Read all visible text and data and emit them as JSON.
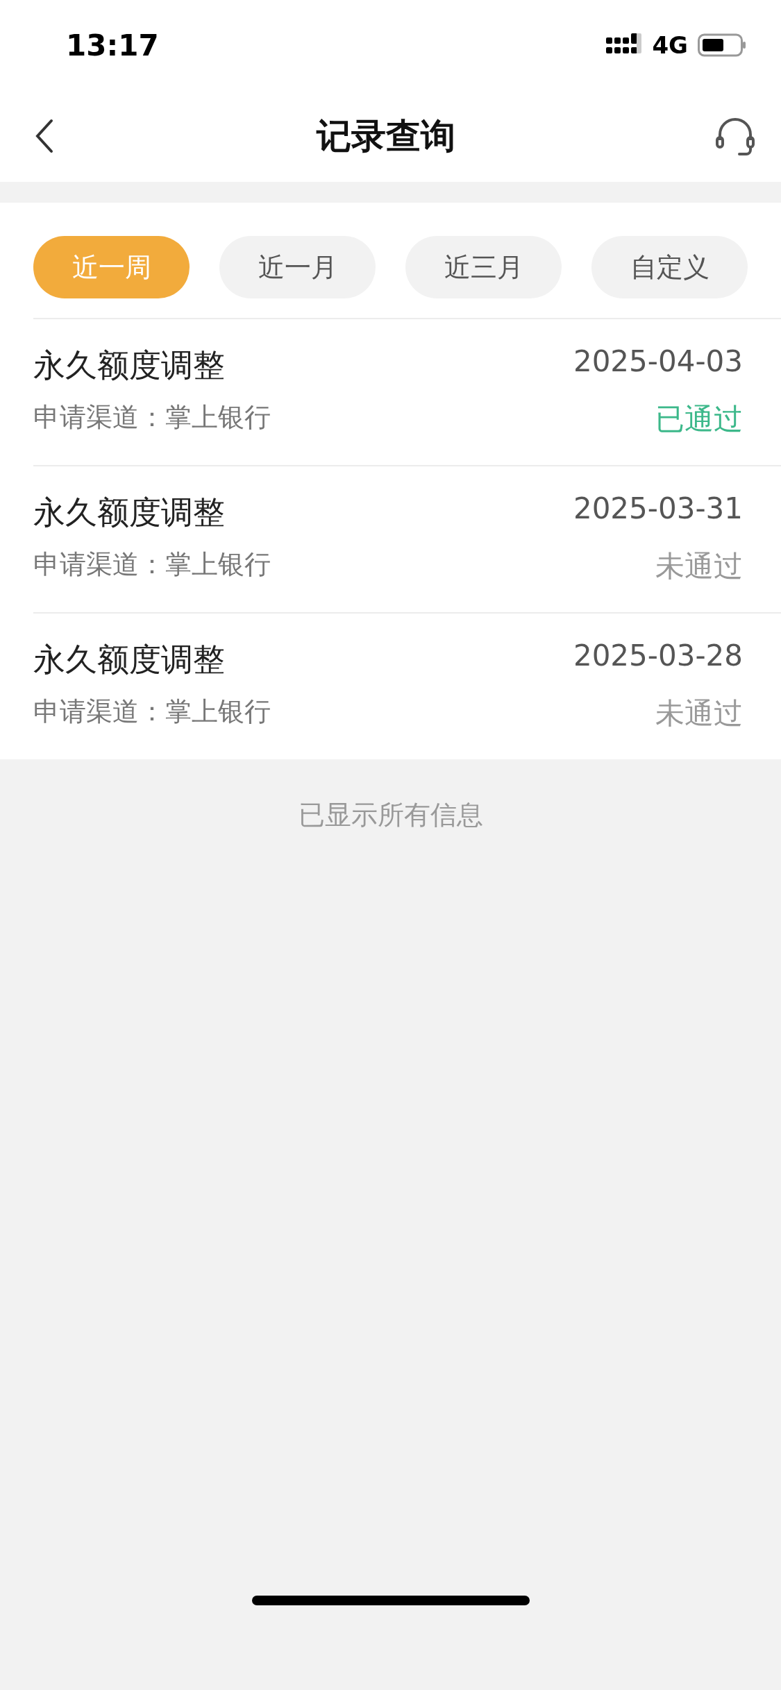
{
  "status_bar": {
    "time": "13:17",
    "network": "4G"
  },
  "nav": {
    "title": "记录查询"
  },
  "tabs": [
    {
      "label": "近一周",
      "selected": true
    },
    {
      "label": "近一月",
      "selected": false
    },
    {
      "label": "近三月",
      "selected": false
    },
    {
      "label": "自定义",
      "selected": false
    }
  ],
  "records": [
    {
      "title": "永久额度调整",
      "date": "2025-04-03",
      "channel": "申请渠道：掌上银行",
      "status": "已通过",
      "passed": true
    },
    {
      "title": "永久额度调整",
      "date": "2025-03-31",
      "channel": "申请渠道：掌上银行",
      "status": "未通过",
      "passed": false
    },
    {
      "title": "永久额度调整",
      "date": "2025-03-28",
      "channel": "申请渠道：掌上银行",
      "status": "未通过",
      "passed": false
    }
  ],
  "footer_note": "已显示所有信息"
}
